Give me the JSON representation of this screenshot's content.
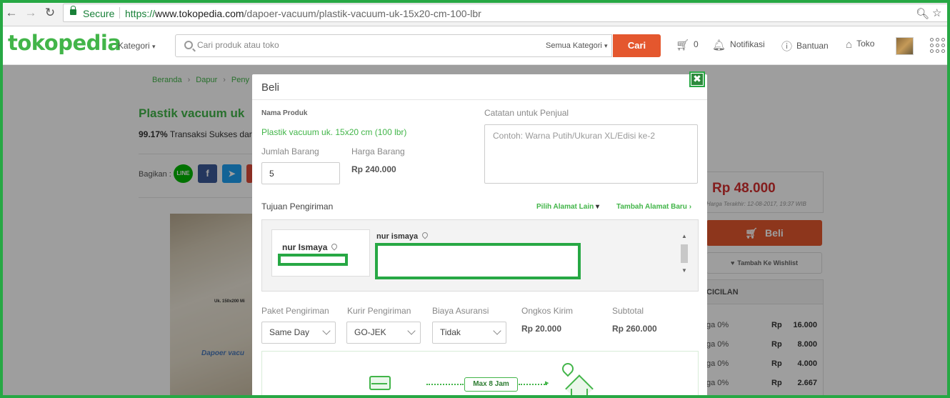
{
  "browser": {
    "secure_label": "Secure",
    "url_scheme": "https://",
    "url_host": "www.tokopedia.com",
    "url_path": "/dapoer-vacuum/plastik-vacuum-uk-15x20-cm-100-lbr"
  },
  "header": {
    "logo": "tokopedia",
    "kategori": "Kategori",
    "search_placeholder": "Cari produk atau toko",
    "search_category": "Semua Kategori",
    "search_button": "Cari",
    "cart_count": "0",
    "notifikasi": "Notifikasi",
    "bantuan": "Bantuan",
    "toko": "Toko"
  },
  "breadcrumb": [
    "Beranda",
    "Dapur",
    "Peny"
  ],
  "product_page": {
    "title": "Plastik vacuum uk",
    "success_rate": "99.17%",
    "success_text": "Transaksi Sukses dari",
    "bagikan": "Bagikan :",
    "image_label": "Uk. 150x200 Mi",
    "image_brand": "Dapoer vacu",
    "price": "Rp 48.000",
    "harga_terakhir": "Harga Terakhir: 12-08-2017, 19:37 WIB",
    "beli_button": "Beli",
    "wishlist_button": "Tambah Ke Wishlist",
    "cicilan_title": "CICILAN",
    "cicilan_rows": [
      {
        "term": "ga 0%",
        "rp": "Rp",
        "value": "16.000"
      },
      {
        "term": "ga 0%",
        "rp": "Rp",
        "value": "8.000"
      },
      {
        "term": "ga 0%",
        "rp": "Rp",
        "value": "4.000"
      },
      {
        "term": "ga 0%",
        "rp": "Rp",
        "value": "2.667"
      }
    ]
  },
  "modal": {
    "title": "Beli",
    "nama_produk_label": "Nama Produk",
    "nama_produk": "Plastik vacuum uk. 15x20 cm (100 lbr)",
    "jumlah_label": "Jumlah Barang",
    "jumlah_value": "5",
    "harga_label": "Harga Barang",
    "harga_value": "Rp 240.000",
    "catatan_label": "Catatan untuk Penjual",
    "catatan_placeholder": "Contoh: Warna Putih/Ukuran XL/Edisi ke-2",
    "tujuan_label": "Tujuan Pengiriman",
    "pilih_alamat": "Pilih Alamat Lain",
    "tambah_alamat": "Tambah Alamat Baru",
    "address_card_name": "nur Ismaya",
    "address_detail_name": "nur ismaya",
    "paket_label": "Paket Pengiriman",
    "paket_value": "Same Day",
    "kurir_label": "Kurir Pengiriman",
    "kurir_value": "GO-JEK",
    "asuransi_label": "Biaya Asuransi",
    "asuransi_value": "Tidak",
    "ongkos_label": "Ongkos Kirim",
    "ongkos_value": "Rp 20.000",
    "subtotal_label": "Subtotal",
    "subtotal_value": "Rp 260.000",
    "delivery_badge": "Max 8 Jam"
  },
  "colors": {
    "brand_green": "#42b549",
    "accent_orange": "#e4572e",
    "price_red": "#d32f2f",
    "annotation_green": "#27a844"
  }
}
